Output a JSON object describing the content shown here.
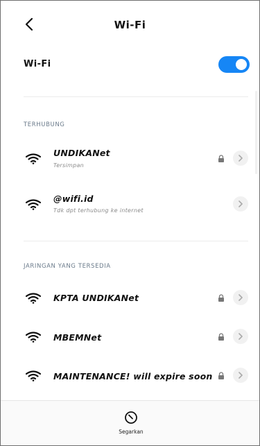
{
  "header": {
    "title": "Wi-Fi"
  },
  "wifi_toggle": {
    "label": "Wi-Fi",
    "enabled": true,
    "accent_color": "#1686f5"
  },
  "connected_section": {
    "label": "TERHUBUNG",
    "networks": [
      {
        "name": "UNDIKANet",
        "subtitle": "Tersimpan",
        "locked": true
      },
      {
        "name": "@wifi.id",
        "subtitle": "Tdk dpt terhubung ke internet",
        "locked": false
      }
    ]
  },
  "available_section": {
    "label": "JARINGAN YANG TERSEDIA",
    "networks": [
      {
        "name": "KPTA UNDIKANet",
        "locked": true
      },
      {
        "name": "MBEMNet",
        "locked": true
      },
      {
        "name": "MAINTENANCE! will expire soon",
        "locked": true
      }
    ]
  },
  "bottom_bar": {
    "refresh_label": "Segarkan",
    "refresh_icon": "refresh-icon"
  }
}
